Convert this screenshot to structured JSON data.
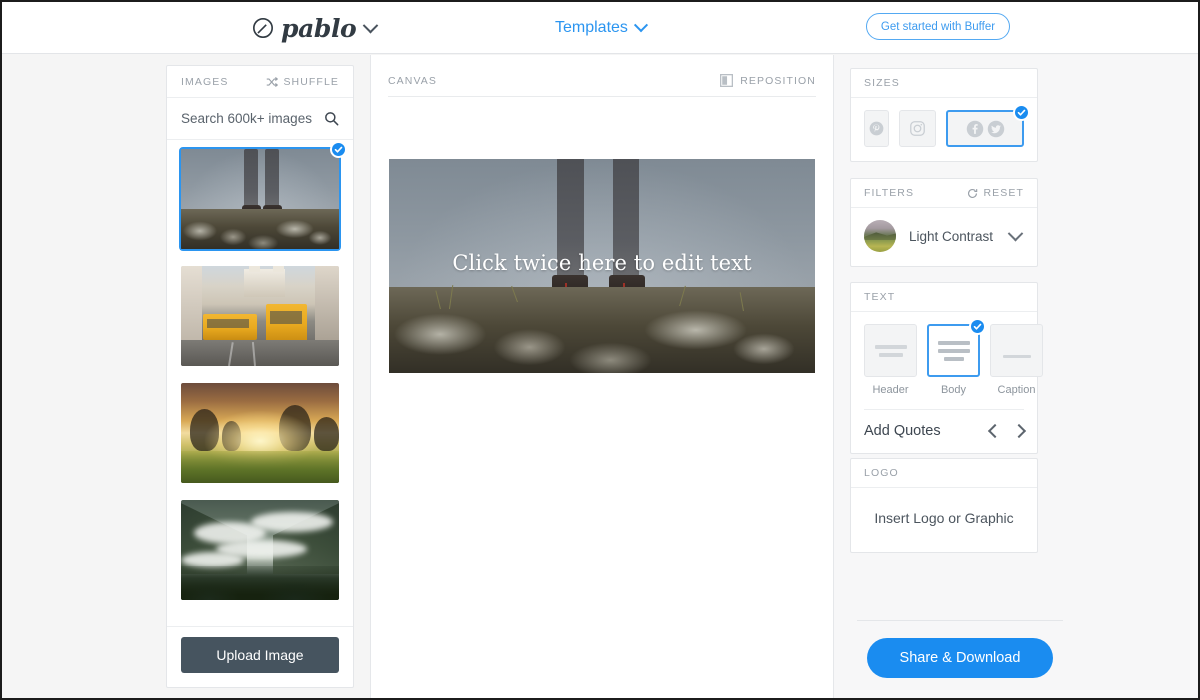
{
  "header": {
    "brand_name": "pablo",
    "brand_icon": "pablo-circle-slash-icon",
    "brand_caret_icon": "chevron-down-icon",
    "templates_label": "Templates",
    "templates_caret_icon": "chevron-down-icon",
    "cta_label": "Get started with Buffer"
  },
  "images_panel": {
    "title": "IMAGES",
    "shuffle_label": "SHUFFLE",
    "shuffle_icon": "shuffle-icon",
    "search_placeholder": "Search 600k+ images",
    "search_value": "",
    "search_icon": "search-icon",
    "check_icon": "check-icon",
    "thumbnails": [
      {
        "alt": "Hiker legs and boots on rocky summit in fog",
        "selected": true
      },
      {
        "alt": "Yellow vintage trams on Lisbon street",
        "selected": false
      },
      {
        "alt": "Golden sunset through trees over a grass field",
        "selected": false
      },
      {
        "alt": "Misty green mountain valley with low clouds",
        "selected": false
      }
    ],
    "upload_label": "Upload Image"
  },
  "canvas_panel": {
    "title": "CANVAS",
    "reposition_label": "REPOSITION",
    "reposition_icon": "reposition-icon",
    "image_alt": "Hiker legs and boots on rocky summit in fog",
    "text": "Click twice here to edit text"
  },
  "sizes": {
    "title": "SIZES",
    "check_icon": "check-icon",
    "options": [
      {
        "name": "pinterest",
        "icon": "pinterest-icon",
        "shape": "tall",
        "selected": false
      },
      {
        "name": "instagram",
        "icon": "instagram-icon",
        "shape": "square",
        "selected": false
      },
      {
        "name": "facebook-twitter",
        "icon": "facebook-twitter-icon",
        "shape": "wide",
        "selected": true
      }
    ]
  },
  "filters": {
    "title": "FILTERS",
    "reset_label": "RESET",
    "reset_icon": "reset-circle-arrow-icon",
    "selected_filter": "Light Contrast",
    "chevron_icon": "chevron-down-icon",
    "thumb_alt": "filter preview landscape"
  },
  "text_section": {
    "title": "TEXT",
    "check_icon": "check-icon",
    "options": [
      {
        "label": "Header",
        "selected": false
      },
      {
        "label": "Body",
        "selected": true
      },
      {
        "label": "Caption",
        "selected": false
      }
    ],
    "quotes_label": "Add Quotes",
    "prev_icon": "chevron-left-icon",
    "next_icon": "chevron-right-icon"
  },
  "logo_section": {
    "title": "LOGO",
    "insert_label": "Insert Logo or Graphic"
  },
  "footer": {
    "share_label": "Share & Download"
  },
  "colors": {
    "accent_blue": "#1a8cf0",
    "link_blue": "#2b95f0",
    "dark_slate": "#46545f",
    "page_bg": "#f5f5f5",
    "card_border": "#e4e6e9",
    "muted_text": "#9aa1a9"
  }
}
